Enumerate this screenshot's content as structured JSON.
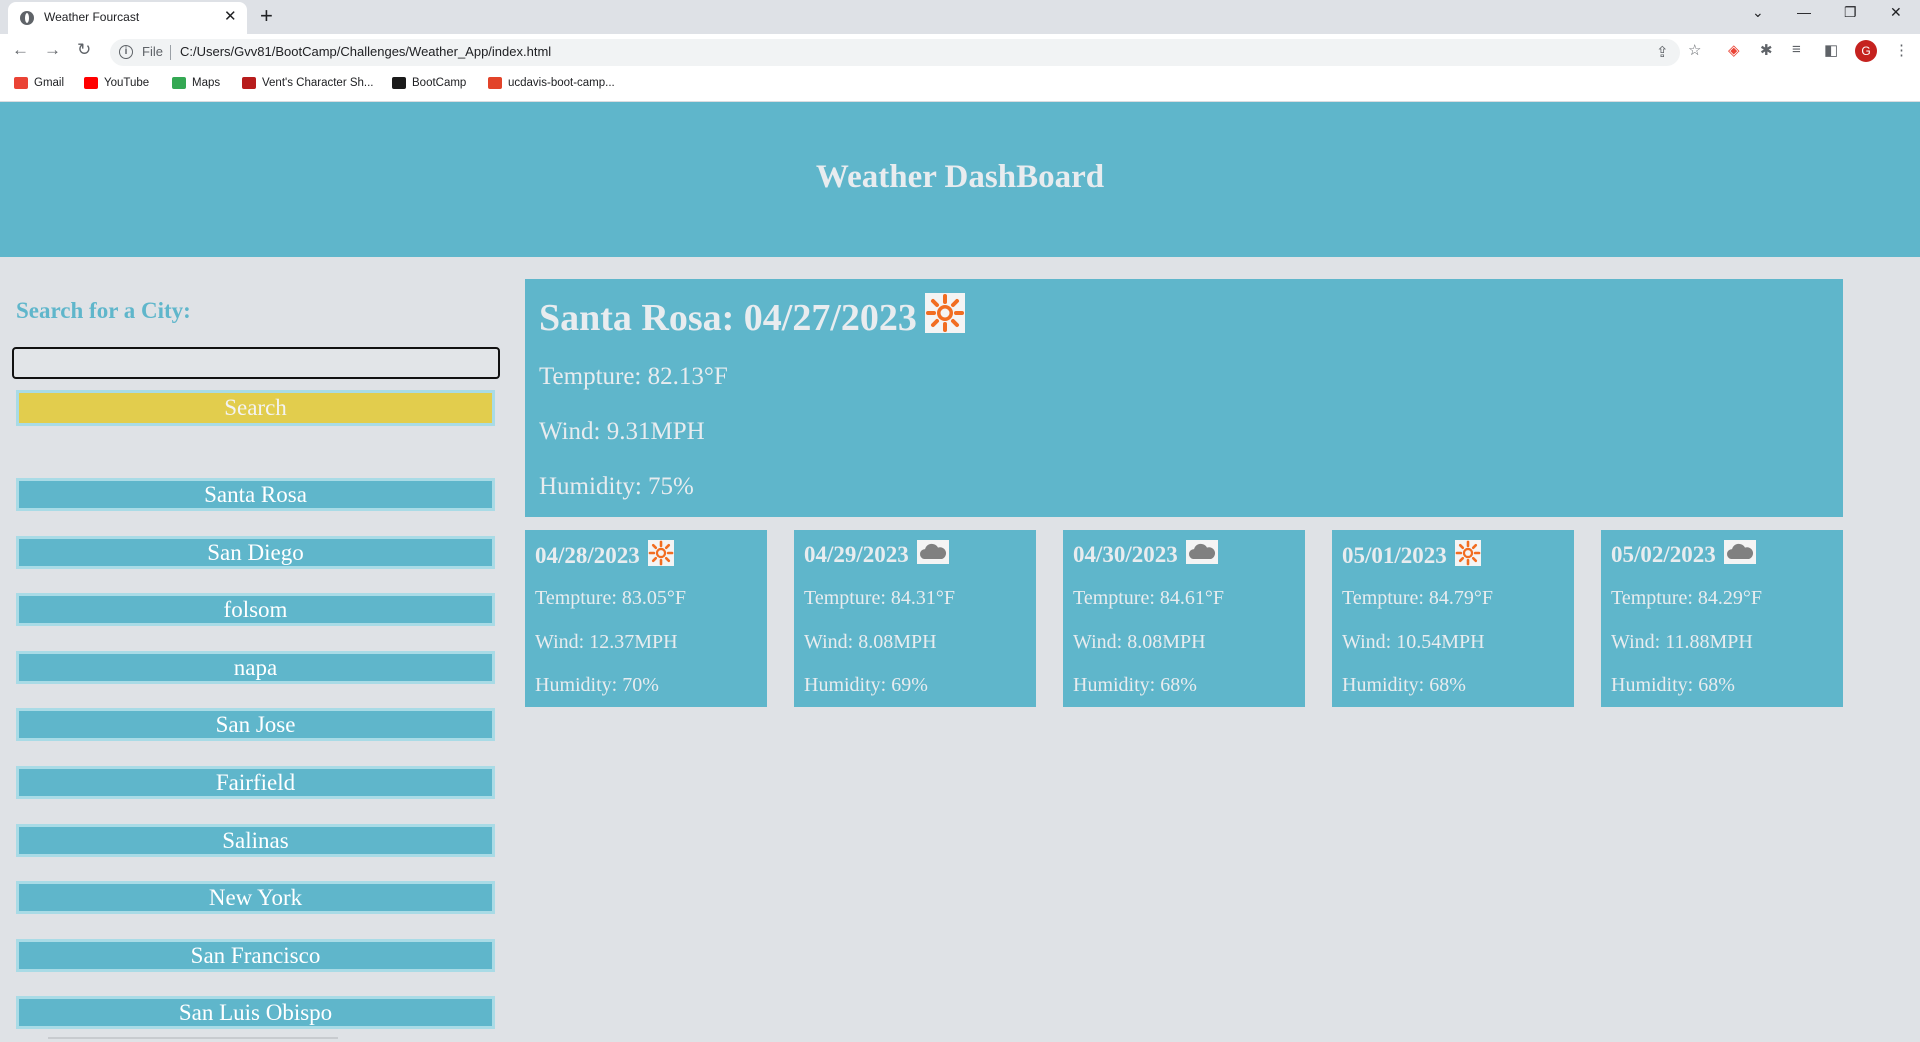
{
  "browser": {
    "tab_title": "Weather Fourcast",
    "tab_close": "✕",
    "new_tab": "+",
    "file_label": "File",
    "url": "C:/Users/Gvv81/BootCamp/Challenges/Weather_App/index.html",
    "profile_initial": "G",
    "window_controls": {
      "dropdown": "⌄",
      "minimize": "—",
      "restore": "❐",
      "close": "✕"
    },
    "nav": {
      "back": "←",
      "forward": "→",
      "reload": "↻"
    },
    "bookmarks": [
      {
        "label": "Gmail",
        "icon": "gmail-icon",
        "color": "#ea4335"
      },
      {
        "label": "YouTube",
        "icon": "youtube-icon",
        "color": "#ff0000"
      },
      {
        "label": "Maps",
        "icon": "maps-icon",
        "color": "#34a853"
      },
      {
        "label": "Vent's Character Sh...",
        "icon": "vent-icon",
        "color": "#b71c1c"
      },
      {
        "label": "BootCamp",
        "icon": "bootcamp-icon",
        "color": "#1a1a1a"
      },
      {
        "label": "ucdavis-boot-camp...",
        "icon": "gitlab-icon",
        "color": "#e24329"
      }
    ]
  },
  "page": {
    "title": "Weather DashBoard",
    "search_label": "Search for a City:",
    "search_value": "",
    "search_button": "Search",
    "history": [
      "Santa Rosa",
      "San Diego",
      "folsom",
      "napa",
      "San Jose",
      "Fairfield",
      "Salinas",
      "New York",
      "San Francisco",
      "San Luis Obispo"
    ]
  },
  "current": {
    "title": "Santa Rosa: 04/27/2023",
    "icon": "sun-icon",
    "temp": "Tempture: 82.13°F",
    "wind": "Wind: 9.31MPH",
    "humidity": "Humidity: 75%"
  },
  "forecast": [
    {
      "date": "04/28/2023",
      "icon": "sun-icon",
      "temp": "Tempture: 83.05°F",
      "wind": "Wind: 12.37MPH",
      "humidity": "Humidity: 70%"
    },
    {
      "date": "04/29/2023",
      "icon": "cloud-icon",
      "temp": "Tempture: 84.31°F",
      "wind": "Wind: 8.08MPH",
      "humidity": "Humidity: 69%"
    },
    {
      "date": "04/30/2023",
      "icon": "cloud-icon",
      "temp": "Tempture: 84.61°F",
      "wind": "Wind: 8.08MPH",
      "humidity": "Humidity: 68%"
    },
    {
      "date": "05/01/2023",
      "icon": "sun-icon",
      "temp": "Tempture: 84.79°F",
      "wind": "Wind: 10.54MPH",
      "humidity": "Humidity: 68%"
    },
    {
      "date": "05/02/2023",
      "icon": "cloud-icon",
      "temp": "Tempture: 84.29°F",
      "wind": "Wind: 11.88MPH",
      "humidity": "Humidity: 68%"
    }
  ],
  "colors": {
    "accent": "#5fb6cb",
    "search_button": "#e2cd4d",
    "sun": "#f26d21",
    "cloud": "#808080"
  }
}
